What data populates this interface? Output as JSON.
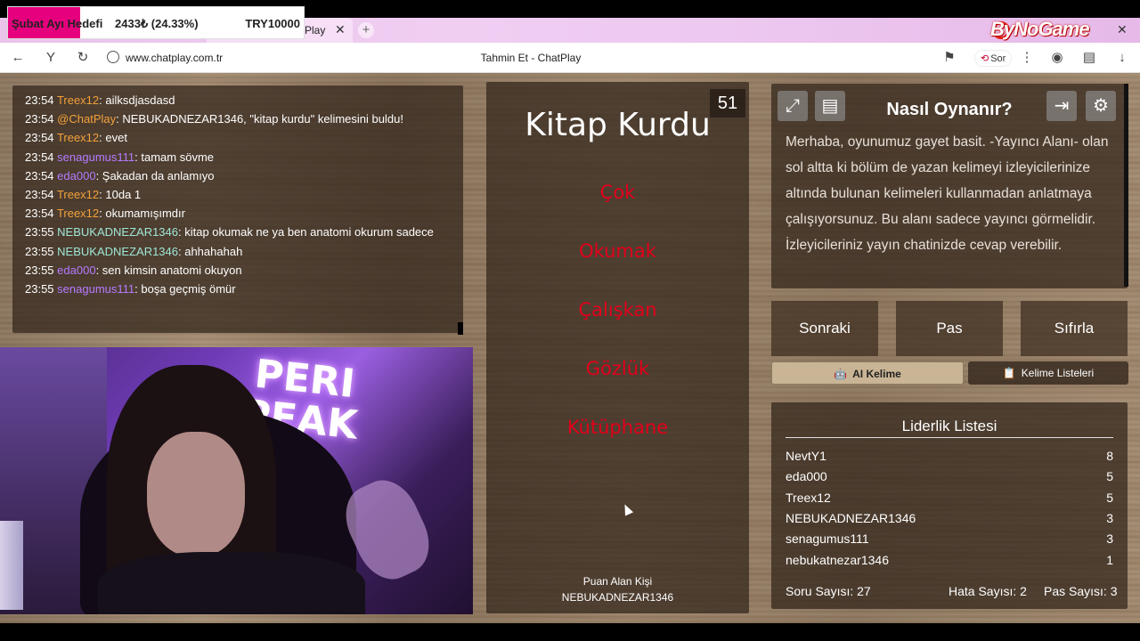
{
  "goal_widget": {
    "label": "Şubat Ayı Hedefi",
    "progress_text": "2433₺ (24.33%)",
    "target_text": "TRY10000",
    "progress_fraction": 0.2433,
    "fill_color": "#e6007e"
  },
  "browser": {
    "tab_title": "Play",
    "tab_close": "✕",
    "new_tab": "+",
    "url": "www.chatplay.com.tr",
    "page_title": "Tahmin Et - ChatPlay",
    "ask_button": "Sor",
    "brand_overlay": "ByNoGame",
    "close": "✕",
    "icons": [
      "back-icon",
      "yandex-icon",
      "reload-icon",
      "lock-icon",
      "bookmark-icon",
      "menu-dots-icon",
      "media-icon",
      "collections-icon",
      "download-icon"
    ]
  },
  "chat": {
    "name_colors": {
      "orange": "#f3a13a",
      "purple": "#b57aff",
      "teal": "#9fe6d6",
      "white": "#ffffff"
    },
    "messages": [
      {
        "time": "23:54",
        "user": "Treex12",
        "color": "orange",
        "text": ": ailksdjasdasd"
      },
      {
        "time": "23:54",
        "user": "@ChatPlay",
        "color": "orange",
        "text": ": NEBUKADNEZAR1346, \"kitap kurdu\" kelimesini buldu!"
      },
      {
        "time": "23:54",
        "user": "Treex12",
        "color": "orange",
        "text": ": evet"
      },
      {
        "time": "23:54",
        "user": "senagumus111",
        "color": "purple",
        "text": ": tamam sövme"
      },
      {
        "time": "23:54",
        "user": "eda000",
        "color": "purple",
        "text": ": Şakadan da anlamıyo"
      },
      {
        "time": "23:54",
        "user": "Treex12",
        "color": "orange",
        "text": ": 10da 1"
      },
      {
        "time": "23:54",
        "user": "Treex12",
        "color": "orange",
        "text": ": okumamışımdır"
      },
      {
        "time": "23:55",
        "user": "NEBUKADNEZAR1346",
        "color": "teal",
        "text": ": kitap okumak ne ya ben anatomi okurum sadece"
      },
      {
        "time": "23:55",
        "user": "NEBUKADNEZAR1346",
        "color": "teal",
        "text": ": ahhahahah"
      },
      {
        "time": "23:55",
        "user": "eda000",
        "color": "purple",
        "text": ": sen kimsin anatomi okuyon"
      },
      {
        "time": "23:55",
        "user": "senagumus111",
        "color": "purple",
        "text": ": boşa geçmiş ömür"
      }
    ]
  },
  "webcam": {
    "sign_line1": "PERI",
    "sign_line2": "PEAK"
  },
  "game": {
    "counter": "51",
    "word": "Kitap Kurdu",
    "taboo_words": [
      "Çok",
      "Okumak",
      "Çalışkan",
      "Gözlük",
      "Kütüphane"
    ],
    "taboo_color": "#e3001b",
    "scorer_label": "Puan Alan Kişi",
    "scorer_name": "NEBUKADNEZAR1346"
  },
  "howto": {
    "title": "Nasıl Oynanır?",
    "text": "Merhaba, oyunumuz gayet basit. -Yayıncı Alanı- olan sol altta ki bölüm de yazan kelimeyi izleyicilerinize altında bulunan kelimeleri kullanmadan anlatmaya çalışıyorsunuz. Bu alanı sadece yayıncı görmelidir. İzleyicileriniz yayın chatinizde cevap verebilir.",
    "icons": [
      "fullscreen-icon",
      "notes-icon",
      "exit-icon",
      "settings-icon"
    ]
  },
  "controls": {
    "next": "Sonraki",
    "pass": "Pas",
    "reset": "Sıfırla",
    "ai_word": "AI Kelime",
    "word_lists": "Kelime Listeleri"
  },
  "leaderboard": {
    "title": "Liderlik Listesi",
    "rows": [
      {
        "name": "NevtY1",
        "score": "8"
      },
      {
        "name": "eda000",
        "score": "5"
      },
      {
        "name": "Treex12",
        "score": "5"
      },
      {
        "name": "NEBUKADNEZAR1346",
        "score": "3"
      },
      {
        "name": "senagumus111",
        "score": "3"
      },
      {
        "name": "nebukatnezar1346",
        "score": "1"
      }
    ],
    "question_count": "Soru Sayısı: 27",
    "error_count": "Hata Sayısı: 2",
    "pass_count": "Pas Sayısı: 3"
  }
}
